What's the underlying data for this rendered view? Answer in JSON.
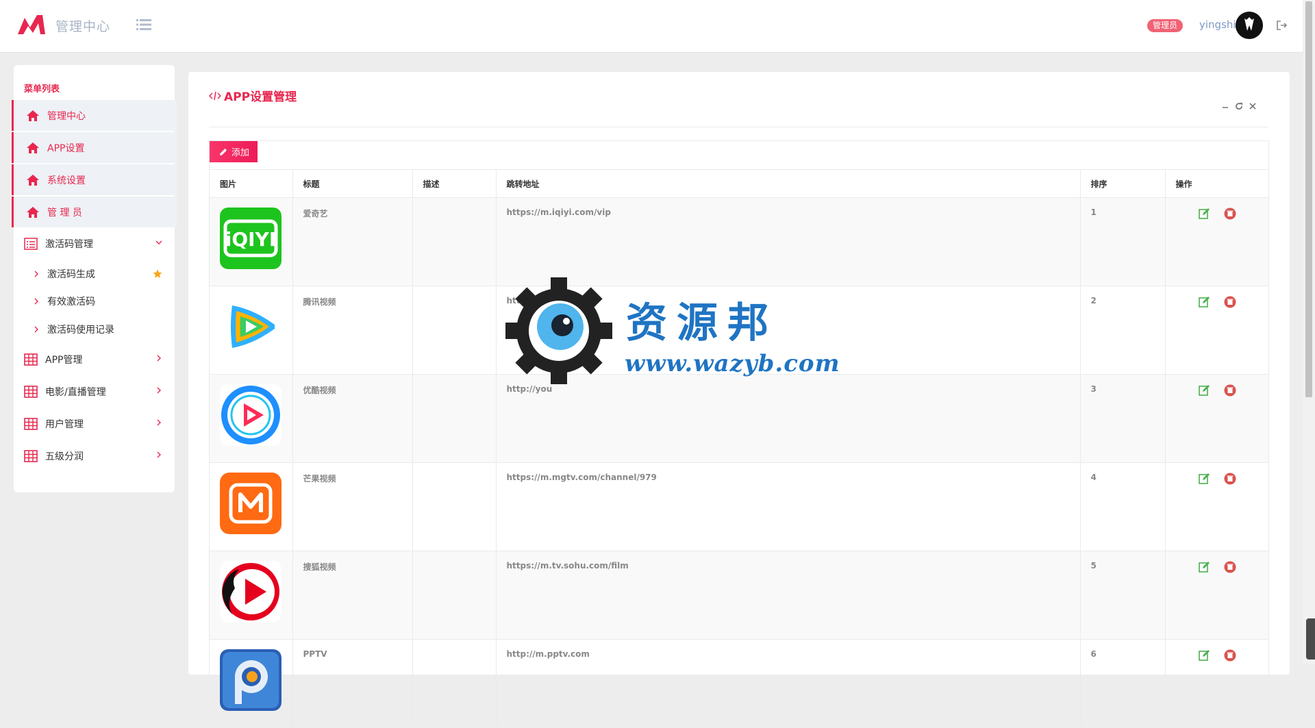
{
  "header": {
    "brand_title": "管理中心",
    "role_badge": "管理员",
    "username": "yingshi",
    "accent_color": "#e8274f"
  },
  "sidebar": {
    "heading": "菜单列表",
    "items": [
      {
        "label": "管理中心",
        "icon": "home-icon",
        "active": true
      },
      {
        "label": "APP设置",
        "icon": "home-icon",
        "active": true
      },
      {
        "label": "系统设置",
        "icon": "home-icon",
        "active": true
      },
      {
        "label": "管 理 员",
        "icon": "home-icon",
        "active": true
      },
      {
        "label": "激活码管理",
        "icon": "list-icon",
        "expanded": true
      },
      {
        "label": "APP管理",
        "icon": "grid-icon"
      },
      {
        "label": "电影/直播管理",
        "icon": "grid-icon"
      },
      {
        "label": "用户管理",
        "icon": "grid-icon"
      },
      {
        "label": "五级分润",
        "icon": "grid-icon"
      }
    ],
    "sub_items": [
      {
        "label": "激活码生成",
        "starred": true
      },
      {
        "label": "有效激活码"
      },
      {
        "label": "激活码使用记录"
      }
    ]
  },
  "panel": {
    "title": "APP设置管理",
    "add_label": "添加",
    "columns": [
      "图片",
      "标题",
      "描述",
      "跳转地址",
      "排序",
      "操作"
    ],
    "rows": [
      {
        "icon": "iqiyi-logo-icon",
        "title": "爱奇艺",
        "desc": "",
        "url": "https://m.iqiyi.com/vip",
        "order": "1"
      },
      {
        "icon": "tencent-video-logo-icon",
        "title": "腾讯视频",
        "desc": "",
        "url": "http",
        "order": "2"
      },
      {
        "icon": "youku-logo-icon",
        "title": "优酷视频",
        "desc": "",
        "url": "http://you",
        "order": "3"
      },
      {
        "icon": "mgtv-logo-icon",
        "title": "芒果视频",
        "desc": "",
        "url": "https://m.mgtv.com/channel/979",
        "order": "4"
      },
      {
        "icon": "sohu-video-logo-icon",
        "title": "搜狐视频",
        "desc": "",
        "url": "https://m.tv.sohu.com/film",
        "order": "5"
      },
      {
        "icon": "pptv-logo-icon",
        "title": "PPTV",
        "desc": "",
        "url": "http://m.pptv.com",
        "order": "6"
      }
    ]
  },
  "watermark": {
    "cn": "资源邦",
    "url": "www.wazyb.com"
  }
}
